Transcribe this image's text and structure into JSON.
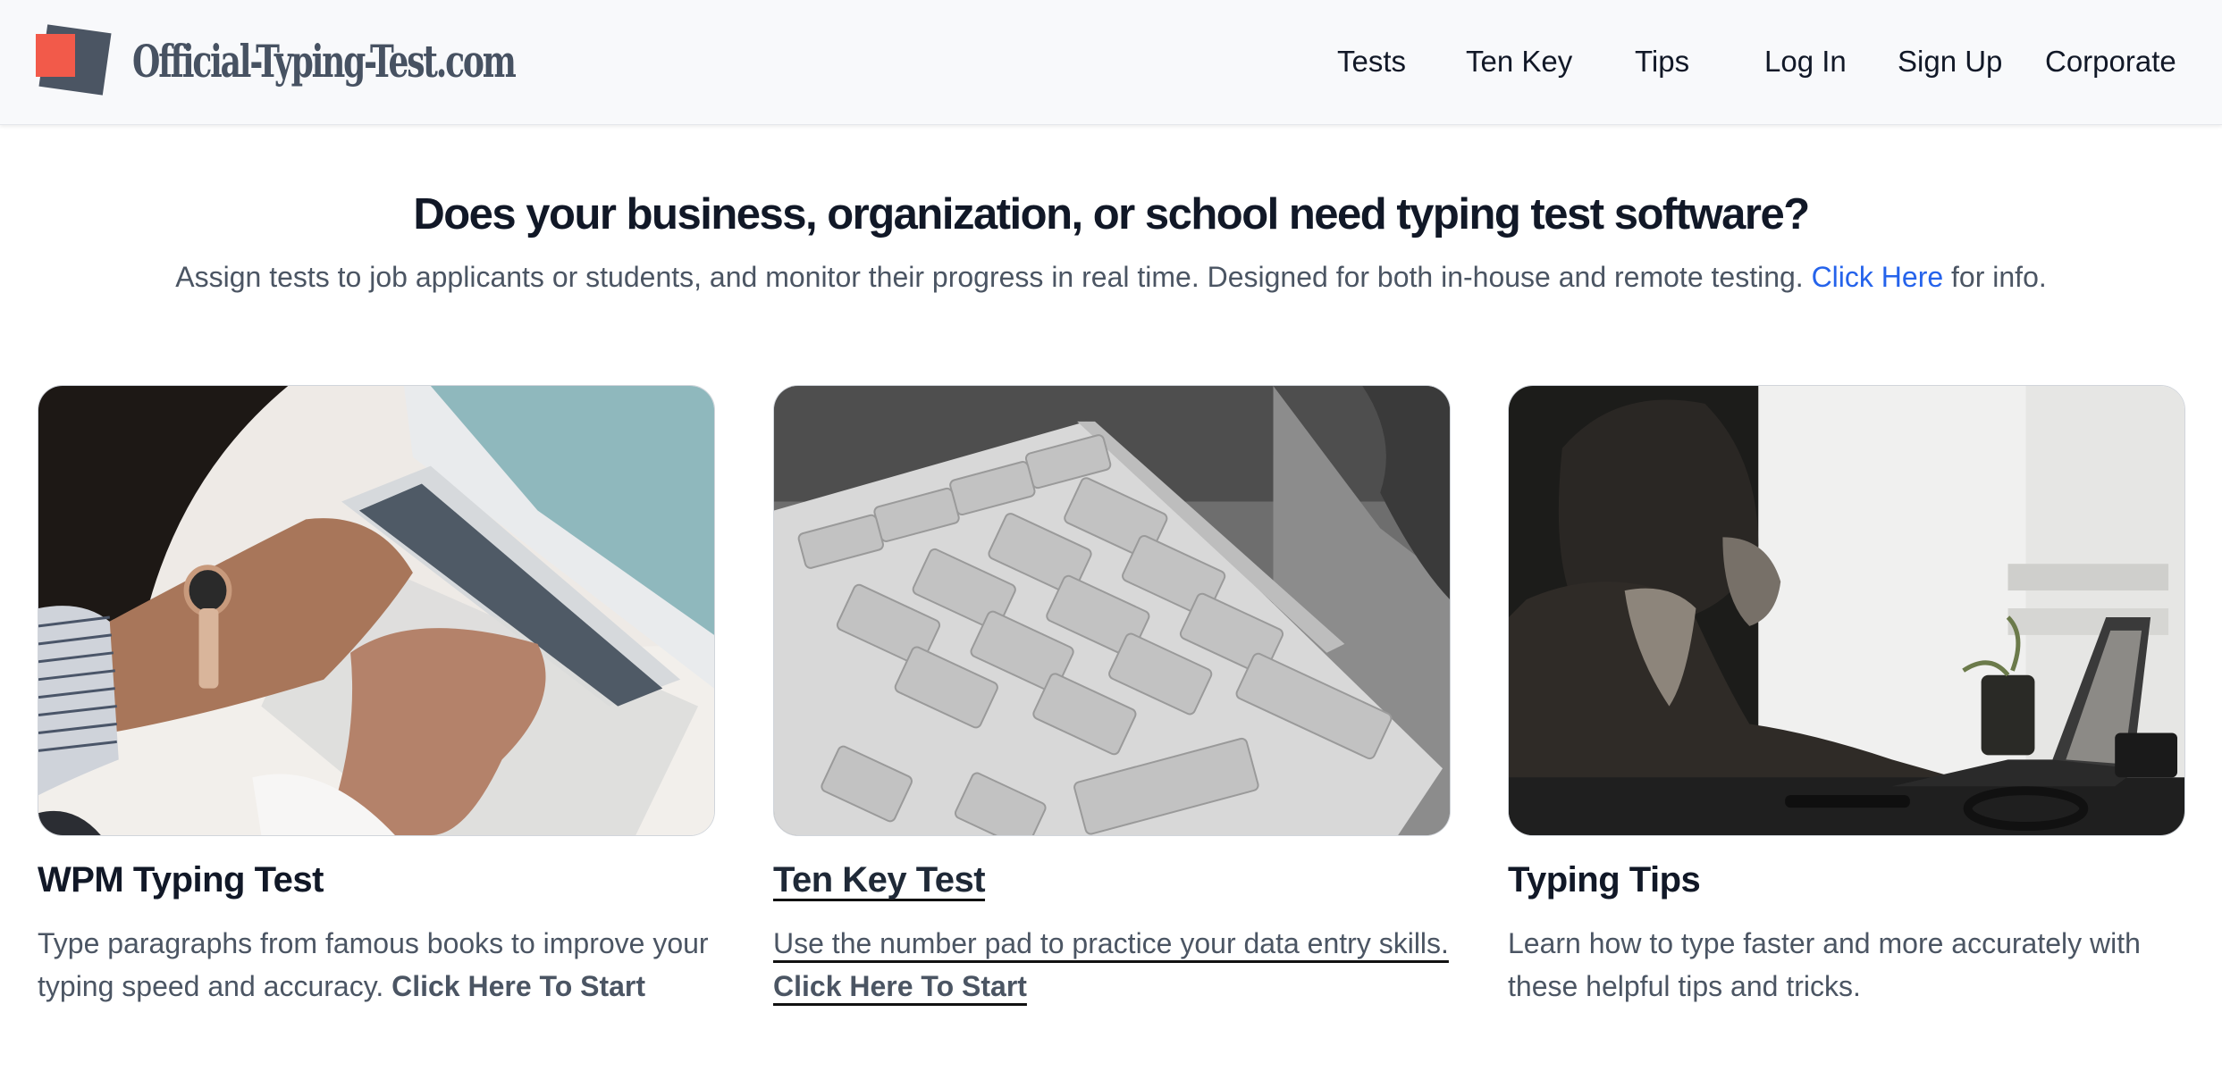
{
  "header": {
    "logo_text": "Official-Typing-Test.com",
    "nav": [
      "Tests",
      "Ten Key",
      "Tips",
      "Log In",
      "Sign Up",
      "Corporate"
    ]
  },
  "hero": {
    "title": "Does your business, organization, or school need typing test software?",
    "subtitle_before": "Assign tests to job applicants or students, and monitor their progress in real time. Designed for both in-house and remote testing.",
    "subtitle_link": "Click Here",
    "subtitle_after": "for info.",
    "link_color": "#2563eb"
  },
  "cards": [
    {
      "image": "hands-typing-on-laptop-photo",
      "title": "WPM Typing Test",
      "description": "Type paragraphs from famous books to improve your typing speed and accuracy.",
      "cta": "Click Here To Start"
    },
    {
      "image": "numeric-keypad-photo",
      "title": "Ten Key Test",
      "description": "Use the number pad to practice your data entry skills.",
      "cta": "Click Here To Start"
    },
    {
      "image": "woman-drinking-coffee-at-laptop-photo",
      "title": "Typing Tips",
      "description": "Learn how to type faster and more accurately with these helpful tips and tricks.",
      "cta": ""
    }
  ],
  "colors": {
    "logo_red": "#f25a4a",
    "logo_slate": "#4b5563",
    "text_dark": "#111827",
    "text_muted": "#4b5563"
  }
}
